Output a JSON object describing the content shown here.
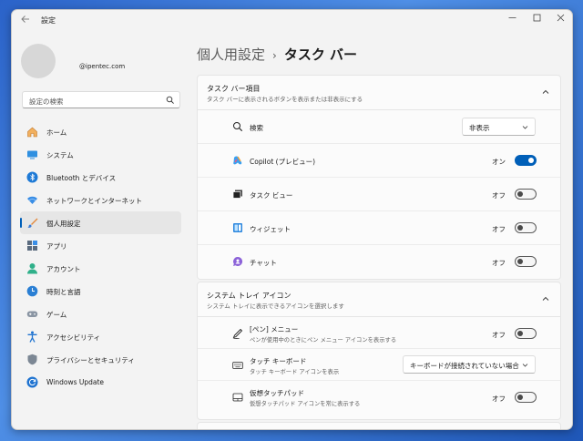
{
  "window": {
    "title": "設定"
  },
  "account": {
    "email": "@ipentec.com"
  },
  "search": {
    "placeholder": "設定の検索"
  },
  "sidebar": {
    "items": [
      {
        "label": "ホーム",
        "icon": "home-icon"
      },
      {
        "label": "システム",
        "icon": "system-icon"
      },
      {
        "label": "Bluetooth とデバイス",
        "icon": "bluetooth-icon"
      },
      {
        "label": "ネットワークとインターネット",
        "icon": "wifi-icon"
      },
      {
        "label": "個人用設定",
        "icon": "brush-icon",
        "active": true
      },
      {
        "label": "アプリ",
        "icon": "apps-icon"
      },
      {
        "label": "アカウント",
        "icon": "account-icon"
      },
      {
        "label": "時刻と言語",
        "icon": "clock-language-icon"
      },
      {
        "label": "ゲーム",
        "icon": "gamepad-icon"
      },
      {
        "label": "アクセシビリティ",
        "icon": "accessibility-icon"
      },
      {
        "label": "プライバシーとセキュリティ",
        "icon": "shield-icon"
      },
      {
        "label": "Windows Update",
        "icon": "windows-update-icon"
      }
    ]
  },
  "breadcrumb": {
    "parent": "個人用設定",
    "separator": "›",
    "current": "タスク バー"
  },
  "taskbar_items": {
    "title": "タスク バー項目",
    "subtitle": "タスク バーに表示されるボタンを表示または非表示にする",
    "rows": [
      {
        "label": "検索",
        "dropdown": "非表示",
        "icon": "search-icon"
      },
      {
        "label": "Copilot (プレビュー)",
        "state": "オン",
        "on": true,
        "icon": "copilot-icon"
      },
      {
        "label": "タスク ビュー",
        "state": "オフ",
        "on": false,
        "icon": "task-view-icon"
      },
      {
        "label": "ウィジェット",
        "state": "オフ",
        "on": false,
        "icon": "widgets-icon"
      },
      {
        "label": "チャット",
        "state": "オフ",
        "on": false,
        "icon": "chat-icon"
      }
    ]
  },
  "tray_icons": {
    "title": "システム トレイ アイコン",
    "subtitle": "システム トレイに表示できるアイコンを選択します",
    "rows": [
      {
        "label": "[ペン] メニュー",
        "sub": "ペンが使用中のときにペン メニュー アイコンを表示する",
        "state": "オフ",
        "on": false,
        "icon": "pen-icon"
      },
      {
        "label": "タッチ キーボード",
        "sub": "タッチ キーボード アイコンを表示",
        "dropdown": "キーボードが接続されていない場合",
        "icon": "keyboard-icon"
      },
      {
        "label": "仮想タッチパッド",
        "sub": "仮想タッチパッド アイコンを常に表示する",
        "state": "オフ",
        "on": false,
        "icon": "touchpad-icon"
      }
    ]
  },
  "colors": {
    "accent": "#005fb8",
    "background": "#f3f3f3",
    "card": "#fbfbfb"
  }
}
